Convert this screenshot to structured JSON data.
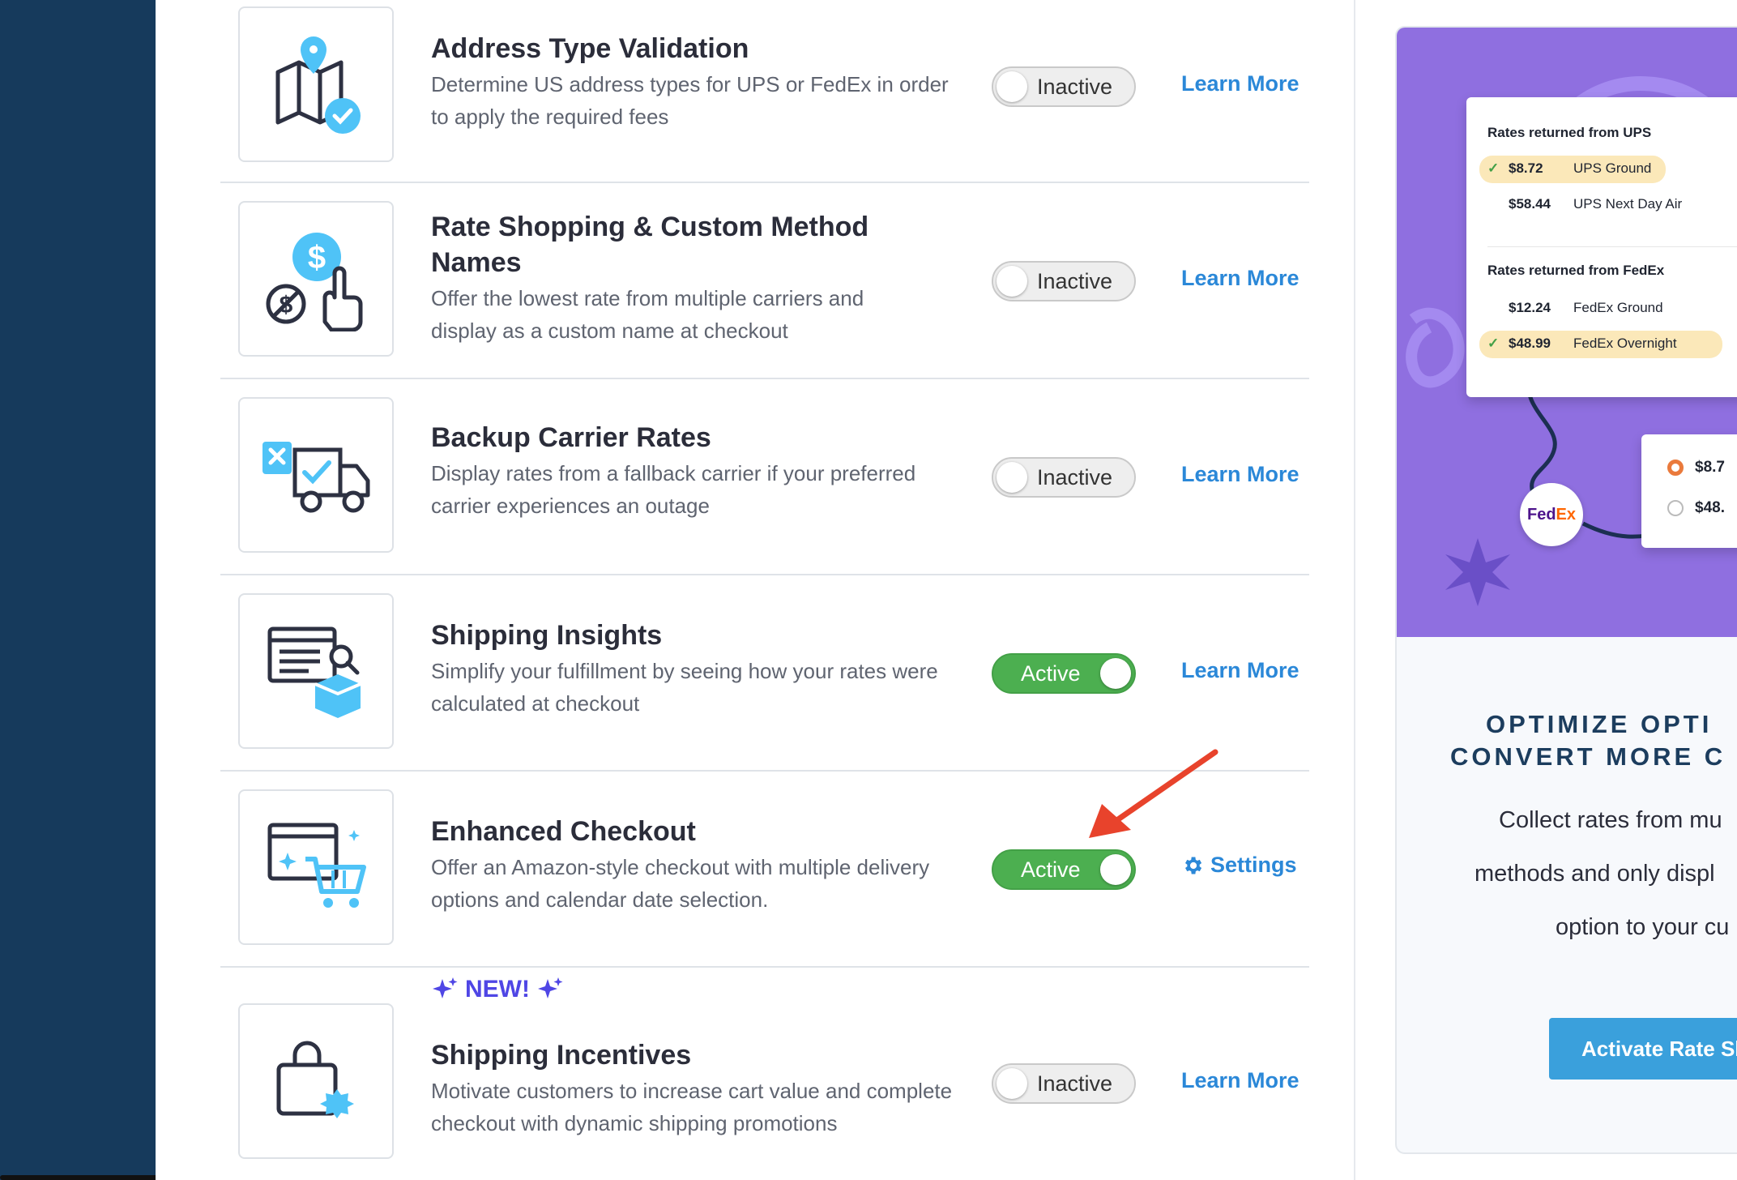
{
  "features": [
    {
      "title": "Address Type Validation",
      "desc": "Determine US address types for UPS or FedEx in order to apply the required fees",
      "status": "Inactive",
      "action": "Learn More",
      "icon": "map-check-icon"
    },
    {
      "title": "Rate Shopping & Custom Method Names",
      "desc": "Offer the lowest rate from multiple carriers and display as a custom name at checkout",
      "status": "Inactive",
      "action": "Learn More",
      "icon": "dollar-hand-icon"
    },
    {
      "title": "Backup Carrier Rates",
      "desc": "Display rates from a fallback carrier if your preferred carrier experiences an outage",
      "status": "Inactive",
      "action": "Learn More",
      "icon": "truck-icon"
    },
    {
      "title": "Shipping Insights",
      "desc": "Simplify your fulfillment by seeing how your rates were calculated at checkout",
      "status": "Active",
      "action": "Learn More",
      "icon": "report-box-icon"
    },
    {
      "title": "Enhanced Checkout",
      "desc": "Offer an Amazon-style checkout with multiple delivery options and calendar date selection.",
      "status": "Active",
      "action": "Settings",
      "icon": "cart-window-icon"
    },
    {
      "title": "Shipping Incentives",
      "desc": "Motivate customers to increase cart value and complete checkout with dynamic shipping promotions",
      "status": "Inactive",
      "action": "Learn More",
      "icon": "bag-badge-icon",
      "badge": "NEW!"
    }
  ],
  "promo": {
    "ups_header": "Rates returned from UPS",
    "ups_rates": [
      {
        "price": "$8.72",
        "service": "UPS Ground",
        "checked": true
      },
      {
        "price": "$58.44",
        "service": "UPS Next Day Air",
        "checked": false
      }
    ],
    "fedex_header": "Rates returned from FedEx",
    "fedex_rates": [
      {
        "price": "$12.24",
        "service": "FedEx Ground",
        "checked": false
      },
      {
        "price": "$48.99",
        "service": "FedEx Overnight",
        "checked": true
      }
    ],
    "choices": [
      "$8.7",
      "$48."
    ],
    "fedex_logo_a": "Fed",
    "fedex_logo_b": "Ex",
    "heading_line1": "OPTIMIZE OPTI",
    "heading_line2": "CONVERT MORE C",
    "body_lines": [
      "Collect rates from mu",
      "methods and only displ",
      "option to your cu"
    ],
    "cta": "Activate Rate Sh"
  },
  "colors": {
    "sidebar": "#163a5c",
    "active": "#4caf50",
    "link": "#2b88d8",
    "promo_bg": "#8f6fe0",
    "cta": "#3aa0dc",
    "new_badge": "#4f46e5",
    "arrow": "#e8432c"
  }
}
